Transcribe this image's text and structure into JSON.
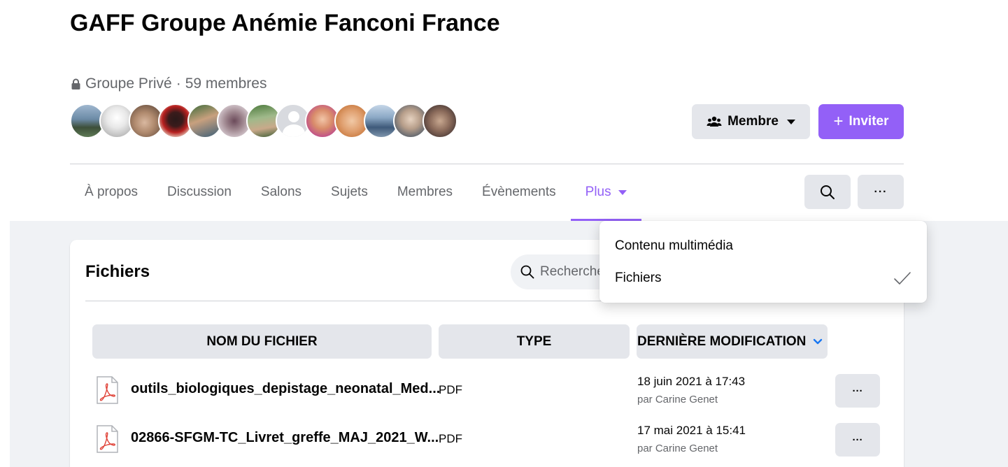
{
  "group": {
    "title": "GAFF Groupe Anémie Fanconi France",
    "privacy": "Groupe Privé",
    "separator": "·",
    "members": "59 membres",
    "member_avatar_count": 13
  },
  "actions": {
    "member_label": "Membre",
    "invite_label": "Inviter",
    "invite_plus": "+"
  },
  "tabs": [
    {
      "label": "À propos"
    },
    {
      "label": "Discussion"
    },
    {
      "label": "Salons"
    },
    {
      "label": "Sujets"
    },
    {
      "label": "Membres"
    },
    {
      "label": "Évènements"
    },
    {
      "label": "Plus",
      "active": true
    }
  ],
  "more_glyph": "···",
  "dropdown": {
    "items": [
      {
        "label": "Contenu multimédia",
        "checked": false
      },
      {
        "label": "Fichiers",
        "checked": true
      }
    ]
  },
  "files": {
    "title": "Fichiers",
    "search_placeholder": "Rechercher",
    "columns": {
      "name": "NOM DU FICHIER",
      "type": "TYPE",
      "modified": "DERNIÈRE MODIFICATION"
    },
    "rows": [
      {
        "name": "outils_biologiques_depistage_neonatal_Med...",
        "type": "PDF",
        "date": "18 juin 2021 à 17:43",
        "by": "par Carine Genet"
      },
      {
        "name": "02866-SFGM-TC_Livret_greffe_MAJ_2021_W...",
        "type": "PDF",
        "date": "17 mai 2021 à 15:41",
        "by": "par Carine Genet"
      }
    ]
  },
  "colors": {
    "accent": "#9360f7",
    "button_gray": "#e4e6eb",
    "page_bg": "#f0f2f5",
    "secondary_text": "#65676b",
    "pdf_red": "#e0443a"
  }
}
